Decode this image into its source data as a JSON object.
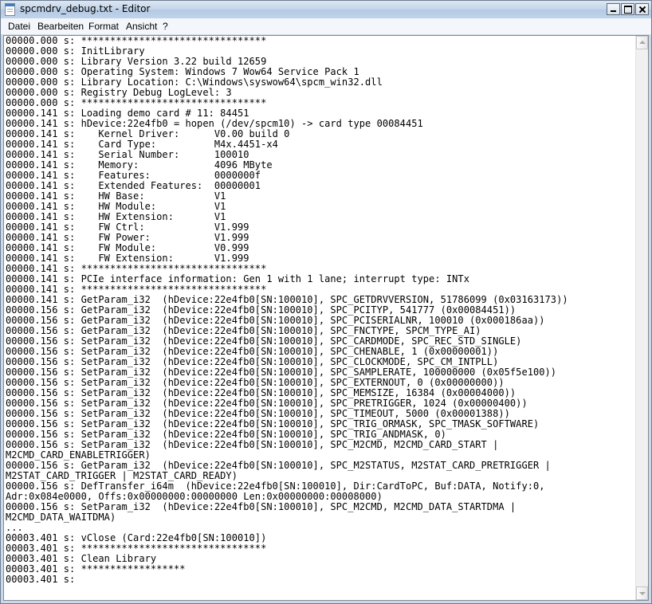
{
  "window": {
    "title": "spcmdrv_debug.txt - Editor"
  },
  "menu": {
    "items": [
      "Datei",
      "Bearbeiten",
      "Format",
      "Ansicht",
      "?"
    ]
  },
  "editor": {
    "lines": [
      "00000.000 s: ********************************",
      "00000.000 s: InitLibrary",
      "00000.000 s: Library Version 3.22 build 12659",
      "00000.000 s: Operating System: Windows 7 Wow64 Service Pack 1",
      "00000.000 s: Library Location: C:\\Windows\\syswow64\\spcm_win32.dll",
      "00000.000 s: Registry Debug LogLevel: 3",
      "00000.000 s: ********************************",
      "00000.141 s: Loading demo card # 11: 84451",
      "00000.141 s: hDevice:22e4fb0 = hopen (/dev/spcm10) -> card type 00084451",
      "00000.141 s:    Kernel Driver:      V0.00 build 0",
      "00000.141 s:    Card Type:          M4x.4451-x4",
      "00000.141 s:    Serial Number:      100010",
      "00000.141 s:    Memory:             4096 MByte",
      "00000.141 s:    Features:           0000000f",
      "00000.141 s:    Extended Features:  00000001",
      "00000.141 s:    HW Base:            V1",
      "00000.141 s:    HW Module:          V1",
      "00000.141 s:    HW Extension:       V1",
      "00000.141 s:    FW Ctrl:            V1.999",
      "00000.141 s:    FW Power:           V1.999",
      "00000.141 s:    FW Module:          V0.999",
      "00000.141 s:    FW Extension:       V1.999",
      "00000.141 s: ********************************",
      "00000.141 s: PCIe interface information: Gen 1 with 1 lane; interrupt type: INTx",
      "00000.141 s: ********************************",
      "00000.141 s: GetParam_i32  (hDevice:22e4fb0[SN:100010], SPC_GETDRVVERSION, 51786099 (0x03163173))",
      "00000.156 s: GetParam_i32  (hDevice:22e4fb0[SN:100010], SPC_PCITYP, 541777 (0x00084451))",
      "00000.156 s: GetParam_i32  (hDevice:22e4fb0[SN:100010], SPC_PCISERIALNR, 100010 (0x000186aa))",
      "00000.156 s: GetParam_i32  (hDevice:22e4fb0[SN:100010], SPC_FNCTYPE, SPCM_TYPE_AI)",
      "00000.156 s: SetParam_i32  (hDevice:22e4fb0[SN:100010], SPC_CARDMODE, SPC_REC_STD_SINGLE)",
      "00000.156 s: SetParam_i32  (hDevice:22e4fb0[SN:100010], SPC_CHENABLE, 1 (0x00000001))",
      "00000.156 s: SetParam_i32  (hDevice:22e4fb0[SN:100010], SPC_CLOCKMODE, SPC_CM_INTPLL)",
      "00000.156 s: SetParam_i32  (hDevice:22e4fb0[SN:100010], SPC_SAMPLERATE, 100000000 (0x05f5e100))",
      "00000.156 s: SetParam_i32  (hDevice:22e4fb0[SN:100010], SPC_EXTERNOUT, 0 (0x00000000))",
      "00000.156 s: SetParam_i32  (hDevice:22e4fb0[SN:100010], SPC_MEMSIZE, 16384 (0x00004000))",
      "00000.156 s: SetParam_i32  (hDevice:22e4fb0[SN:100010], SPC_PRETRIGGER, 1024 (0x00000400))",
      "00000.156 s: SetParam_i32  (hDevice:22e4fb0[SN:100010], SPC_TIMEOUT, 5000 (0x00001388))",
      "00000.156 s: SetParam_i32  (hDevice:22e4fb0[SN:100010], SPC_TRIG_ORMASK, SPC_TMASK_SOFTWARE)",
      "00000.156 s: SetParam_i32  (hDevice:22e4fb0[SN:100010], SPC_TRIG_ANDMASK, 0)",
      "00000.156 s: SetParam_i32  (hDevice:22e4fb0[SN:100010], SPC_M2CMD, M2CMD_CARD_START |",
      "M2CMD_CARD_ENABLETRIGGER)",
      "00000.156 s: GetParam_i32  (hDevice:22e4fb0[SN:100010], SPC_M2STATUS, M2STAT_CARD_PRETRIGGER |",
      "M2STAT_CARD_TRIGGER | M2STAT_CARD_READY)",
      "00000.156 s: DefTransfer_i64m  (hDevice:22e4fb0[SN:100010], Dir:CardToPC, Buf:DATA, Notify:0,",
      "Adr:0x084e0000, Offs:0x00000000:00000000 Len:0x00000000:00008000)",
      "00000.156 s: SetParam_i32  (hDevice:22e4fb0[SN:100010], SPC_M2CMD, M2CMD_DATA_STARTDMA |",
      "M2CMD_DATA_WAITDMA)",
      "...",
      "00003.401 s: vClose (Card:22e4fb0[SN:100010])",
      "00003.401 s: ********************************",
      "00003.401 s: Clean Library",
      "00003.401 s: ******************",
      "00003.401 s:"
    ]
  }
}
